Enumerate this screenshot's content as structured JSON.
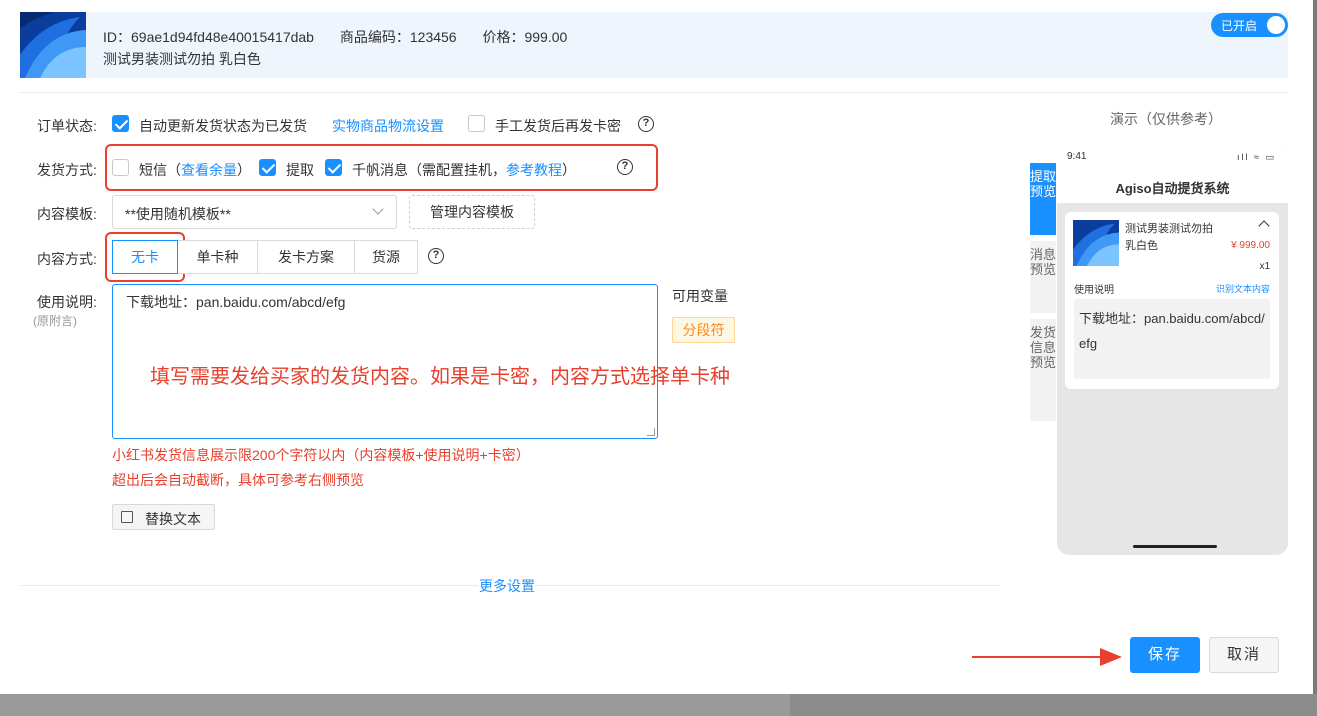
{
  "header": {
    "id_text": "ID：69ae1d94fd48e40015417dab",
    "code_text": "商品编码：123456",
    "price_text": "价格：999.00",
    "title": "测试男装测试勿拍 乳白色",
    "toggle_label": "已开启"
  },
  "form": {
    "order_status": {
      "label": "订单状态:",
      "auto_update": "自动更新发货状态为已发货",
      "logistics_link": "实物商品物流设置",
      "resend_card": "手工发货后再发卡密",
      "help": "?"
    },
    "delivery": {
      "label": "发货方式:",
      "sms": "短信",
      "sms_paren_open": "（",
      "sms_link": "查看余量",
      "sms_paren_close": "）",
      "pickup": "提取",
      "qianfan": "千帆消息（需配置挂机，",
      "tutorial_link": "参考教程",
      "qianfan_close": "）",
      "help": "?"
    },
    "template": {
      "label": "内容模板:",
      "selected": "**使用随机模板**",
      "manage_button": "管理内容模板"
    },
    "content_mode": {
      "label": "内容方式:",
      "options": [
        "无卡",
        "单卡种",
        "发卡方案",
        "货源"
      ],
      "help": "?"
    },
    "usage": {
      "label": "使用说明:",
      "sublabel": "(原附言)",
      "value": "下载地址：pan.baidu.com/abcd/efg",
      "annotation": "填写需要发给买家的发货内容。如果是卡密，内容方式选择单卡种",
      "vars_title": "可用变量",
      "var_tag": "分段符",
      "note_line1": "小红书发货信息展示限200个字符以内（内容模板+使用说明+卡密）",
      "note_line2": "超出后会自动截断，具体可参考右侧预览",
      "replace_button": "替换文本"
    },
    "more_settings": "更多设置"
  },
  "preview": {
    "title": "演示（仅供参考）",
    "tabs": [
      "提取预览",
      "消息预览",
      "发货信息预览"
    ],
    "phone": {
      "time": "9:41",
      "status": "ıll ≈ ▭",
      "app_title": "Agiso自动提货系统",
      "product_name": "测试男装测试勿拍 乳白色",
      "price": "¥ 999.00",
      "qty": "x1",
      "usage_label": "使用说明",
      "recognize_link": "识别文本内容",
      "content": "下载地址：pan.baidu.com/abcd/efg"
    }
  },
  "footer": {
    "save": "保存",
    "cancel": "取消"
  },
  "colors": {
    "primary": "#1890ff",
    "annotation_red": "#e8402c",
    "tag_orange": "#fa8c16"
  }
}
